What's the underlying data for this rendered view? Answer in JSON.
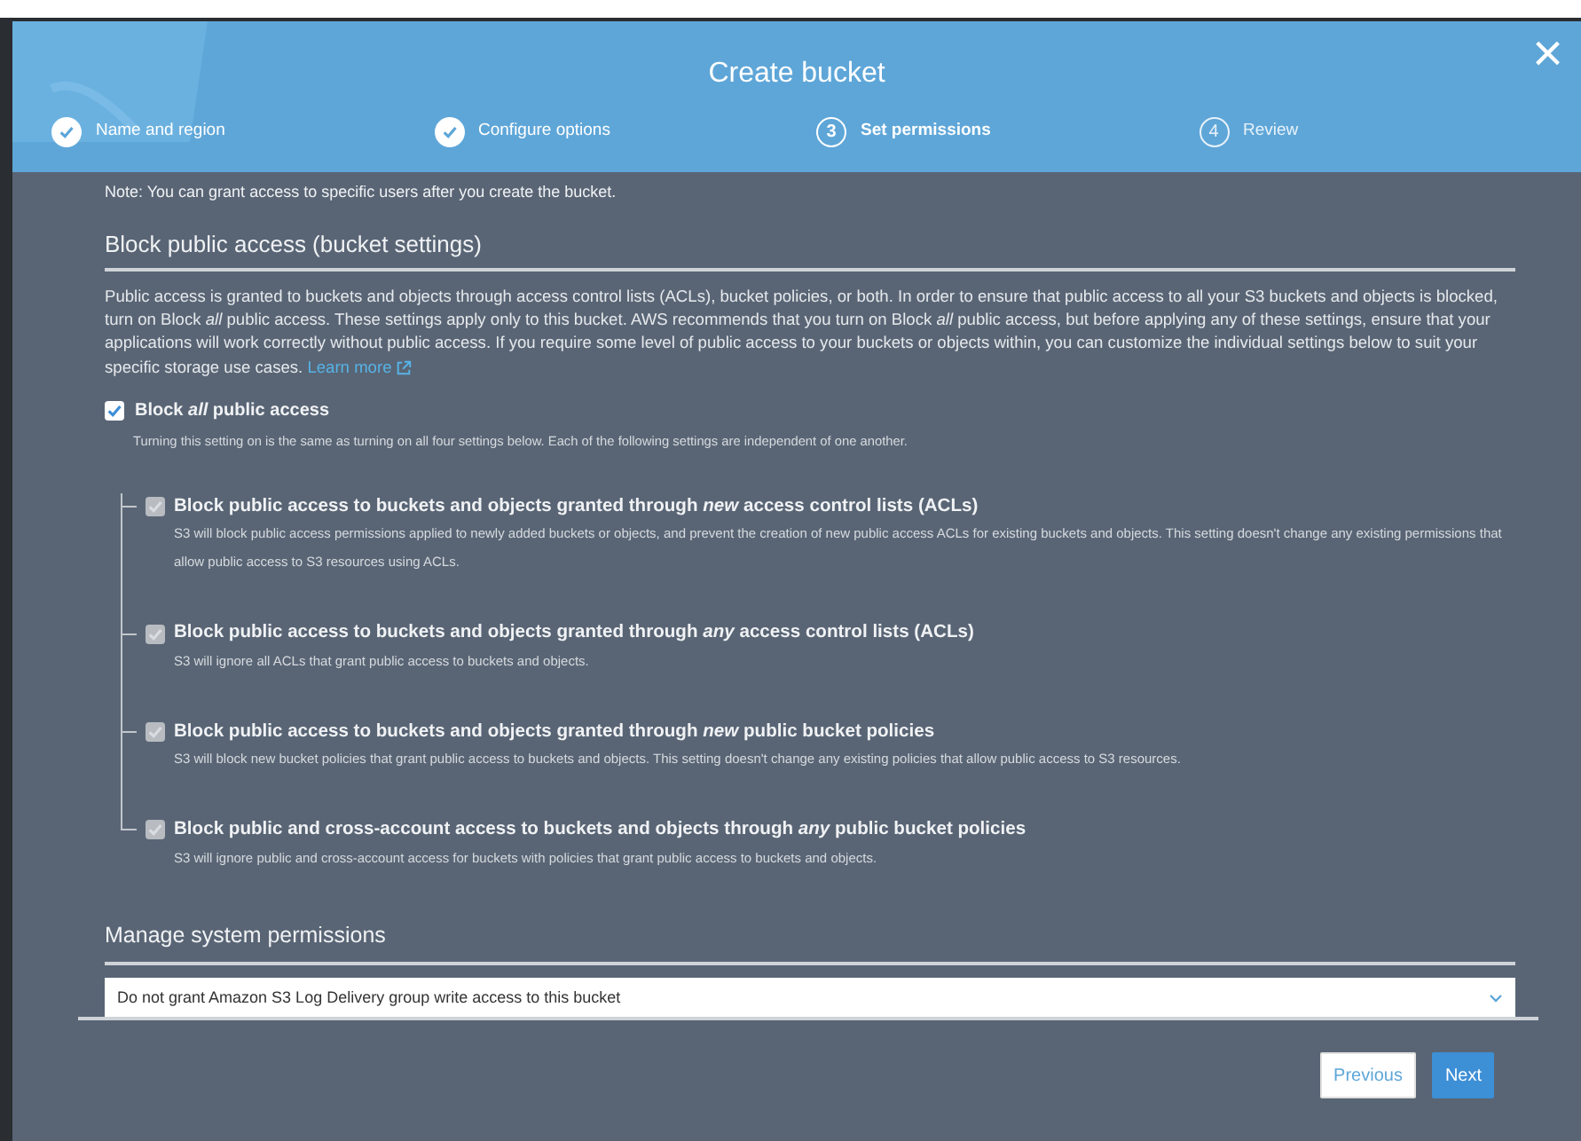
{
  "window": {
    "title": "Create bucket",
    "close": "×"
  },
  "steps": [
    {
      "label": "Name and region",
      "done": true,
      "selected": false
    },
    {
      "label": "Configure options",
      "done": true,
      "selected": false
    },
    {
      "number": "3",
      "label": "Set permissions",
      "done": false,
      "selected": true
    },
    {
      "number": "4",
      "label": "Review",
      "done": false,
      "selected": false
    }
  ],
  "note": "Note: You can grant access to specific users after you create the bucket.",
  "block_public_access": {
    "heading": "Block public access (bucket settings)",
    "description": "Public access is granted to buckets and objects through access control lists (ACLs), bucket policies, or both. In order to ensure that public access to all your S3 buckets and objects is blocked, turn on Block *all* public access. These settings apply only to this bucket. AWS recommends that you turn on Block *all* public access, but before applying any of these settings, ensure that your applications will work correctly without public access. If you require some level of public access to your buckets or objects within, you can customize the individual settings below to suit your specific storage use cases.",
    "learn_more": "Learn more",
    "master": {
      "label": "Block *all* public access",
      "checked": true,
      "disabled": false,
      "hint": "Turning this setting on is the same as turning on all four settings below. Each of the following settings are independent of one another."
    },
    "settings": [
      {
        "label": "Block public access to buckets and objects granted through *new* access control lists (ACLs)",
        "checked": true,
        "disabled": true,
        "hint": "S3 will block public access permissions applied to newly added buckets or objects, and prevent the creation of new public access ACLs for existing buckets and objects. This setting doesn't change any existing permissions that allow public access to S3 resources using ACLs."
      },
      {
        "label": "Block public access to buckets and objects granted through *any* access control lists (ACLs)",
        "checked": true,
        "disabled": true,
        "hint": "S3 will ignore all ACLs that grant public access to buckets and objects."
      },
      {
        "label": "Block public access to buckets and objects granted through *new* public bucket policies",
        "checked": true,
        "disabled": true,
        "hint": "S3 will block new bucket policies that grant public access to buckets and objects. This setting doesn't change any existing policies that allow public access to S3 resources."
      },
      {
        "label": "Block public and cross-account access to buckets and objects through *any* public bucket policies",
        "checked": true,
        "disabled": true,
        "hint": "S3 will ignore public and cross-account access for buckets with policies that grant public access to buckets and objects."
      }
    ]
  },
  "system_permissions": {
    "heading": "Manage system permissions",
    "value": "Do not grant Amazon S3 Log Delivery group write access to this bucket"
  },
  "buttons": [
    {
      "label": "Previous",
      "kind": "secondary"
    },
    {
      "label": "Next",
      "kind": "primary"
    }
  ]
}
